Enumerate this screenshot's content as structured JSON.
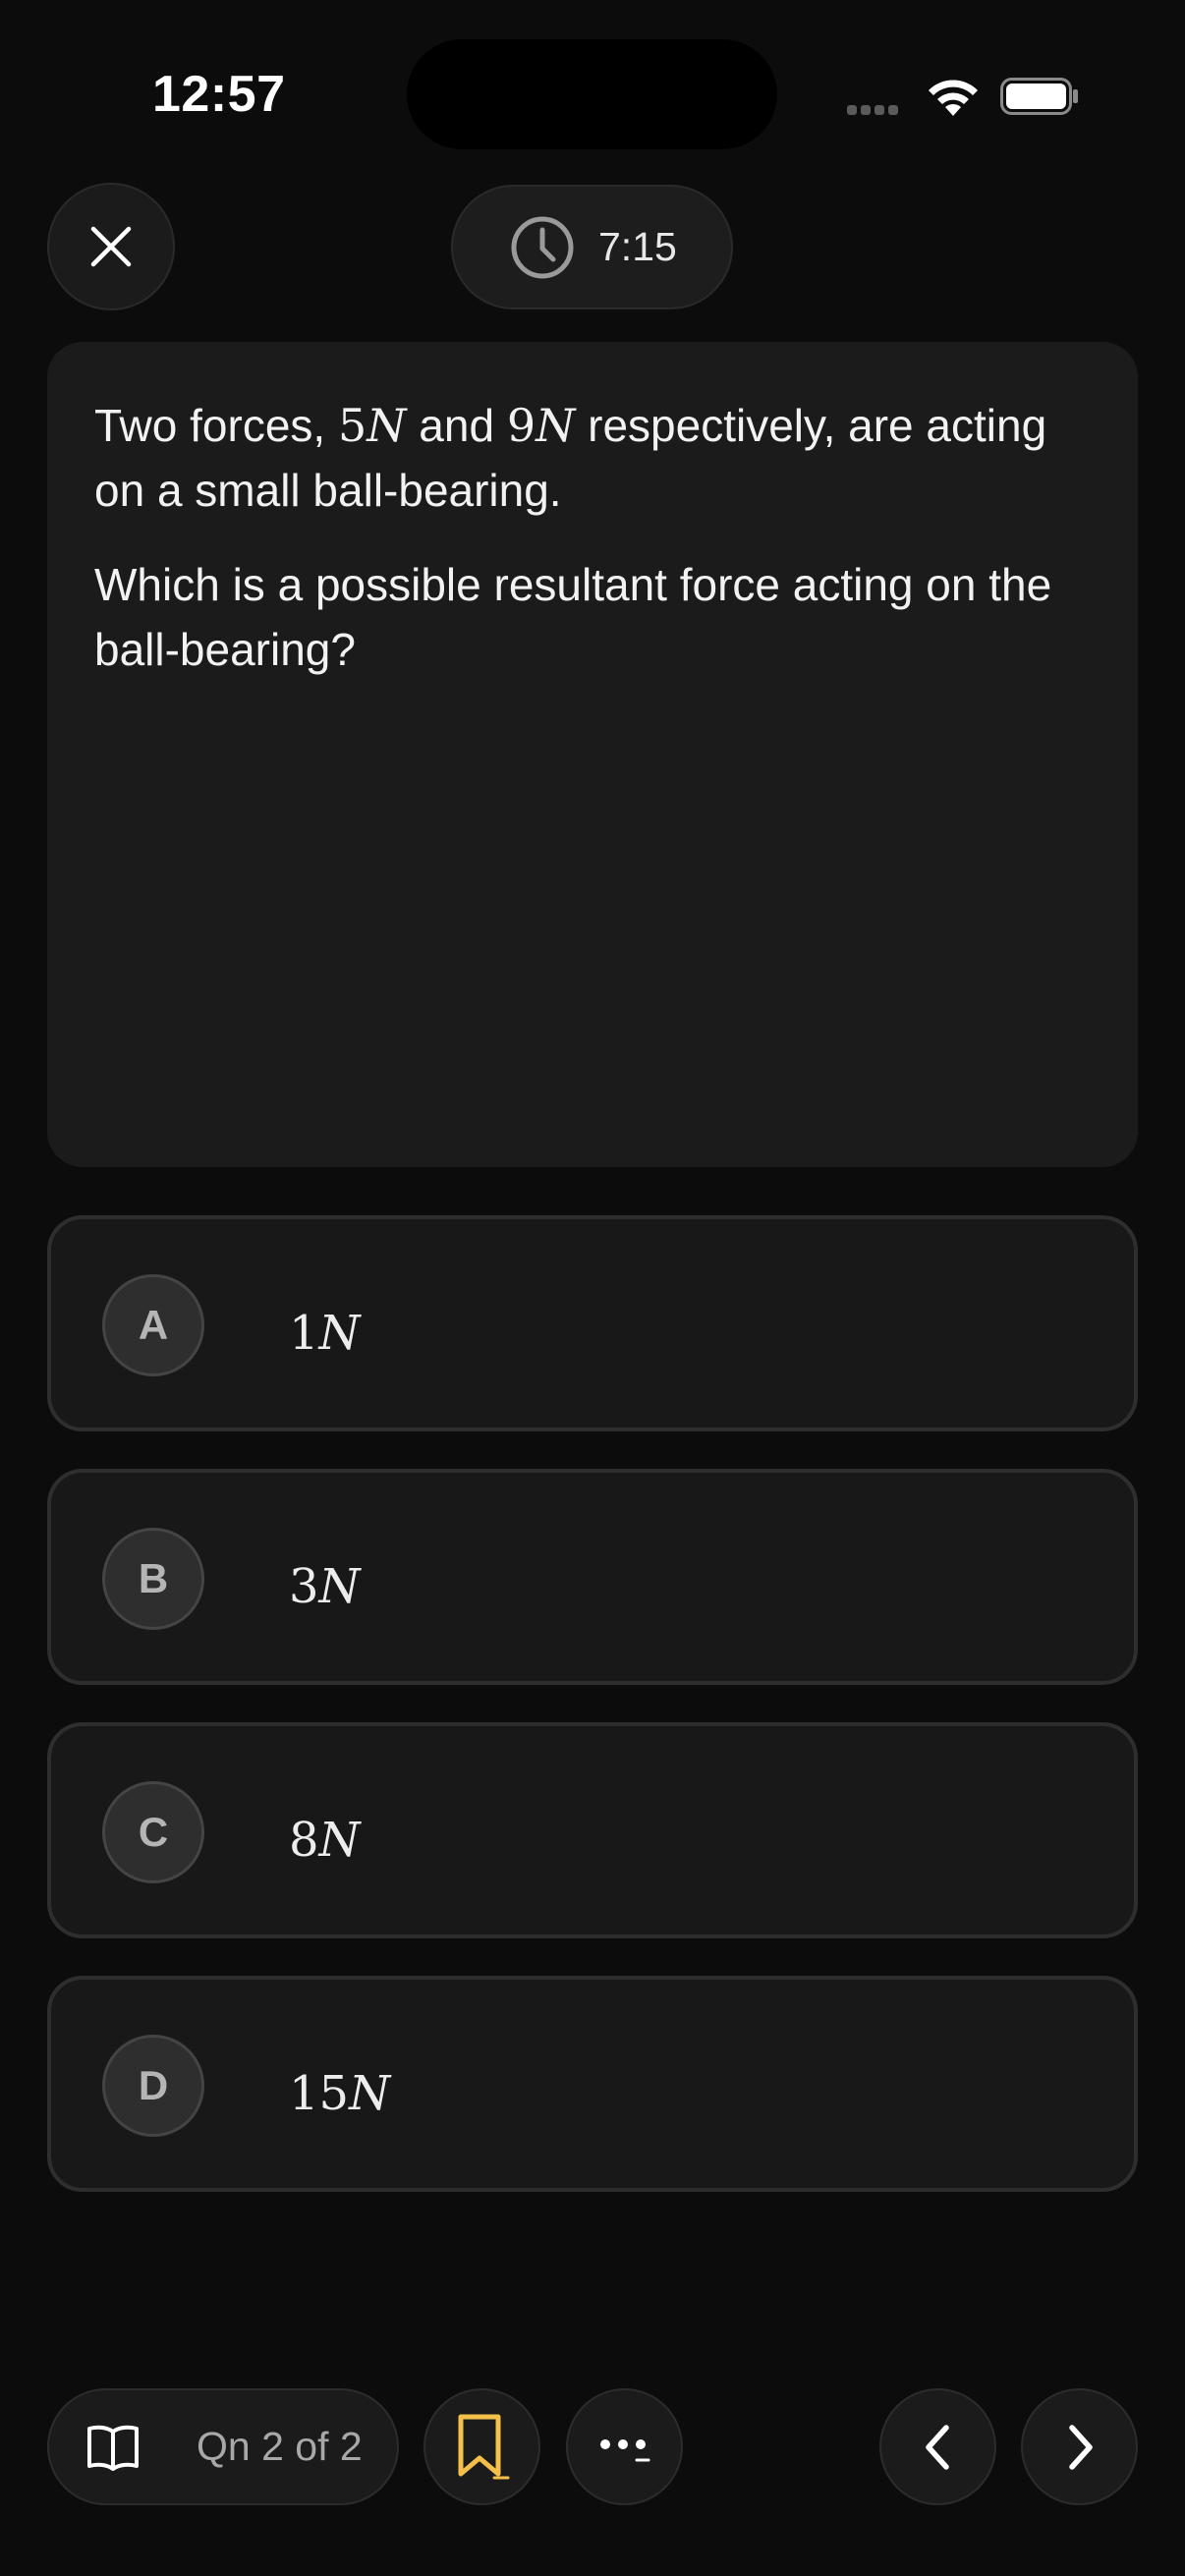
{
  "status_bar": {
    "time": "12:57"
  },
  "top_bar": {
    "close_icon": "close-icon",
    "timer_icon": "clock-icon",
    "timer": "7:15"
  },
  "question": {
    "paragraph1": {
      "part1": "Two forces, ",
      "force1_num": "5",
      "force1_unit": "N",
      "part2": " and ",
      "force2_num": "9",
      "force2_unit": "N",
      "part3": " respectively, are acting on a small ball-bearing."
    },
    "paragraph2": "Which is a possible resultant force acting on the ball-bearing?"
  },
  "options": [
    {
      "letter": "A",
      "num": "1",
      "unit": "N"
    },
    {
      "letter": "B",
      "num": "3",
      "unit": "N"
    },
    {
      "letter": "C",
      "num": "8",
      "unit": "N"
    },
    {
      "letter": "D",
      "num": "15",
      "unit": "N"
    }
  ],
  "bottom_bar": {
    "progress_label": "Qn 2 of 2",
    "icons": [
      "book-icon",
      "bookmark-icon",
      "more-icon",
      "chevron-left-icon",
      "chevron-right-icon"
    ],
    "bookmark_color": "#f5c04a"
  },
  "colors": {
    "background": "#0c0c0c",
    "card": "#1b1b1b",
    "accent": "#f5c04a"
  }
}
